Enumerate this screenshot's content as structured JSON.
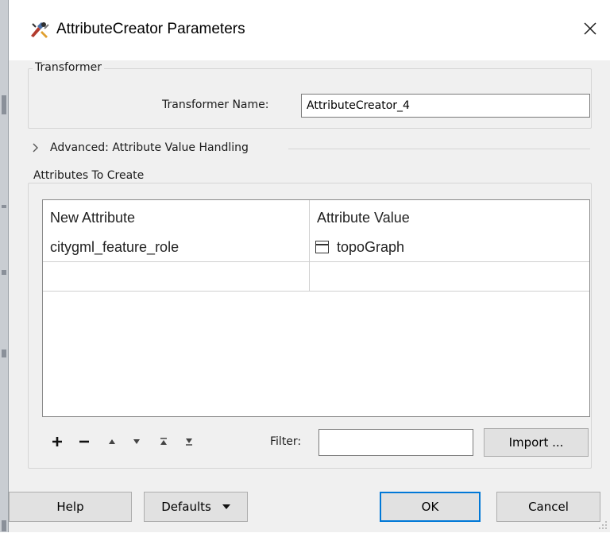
{
  "window": {
    "title": "AttributeCreator Parameters",
    "close_glyph": "✕"
  },
  "transformer_group": {
    "legend": "Transformer",
    "name_label": "Transformer Name:",
    "name_value": "AttributeCreator_4"
  },
  "advanced": {
    "chevron": "›",
    "label": "Advanced: Attribute Value Handling"
  },
  "attributes_group": {
    "legend": "Attributes To Create",
    "columns": [
      "New Attribute",
      "Attribute Value"
    ],
    "rows": [
      {
        "attribute": "citygml_feature_role",
        "value": "topoGraph"
      }
    ]
  },
  "toolbar": {
    "add_glyph": "+",
    "remove_glyph": "−",
    "filter_label": "Filter:",
    "filter_value": "",
    "import_label": "Import ..."
  },
  "footer": {
    "help_label": "Help",
    "defaults_label": "Defaults",
    "ok_label": "OK",
    "cancel_label": "Cancel"
  },
  "icons": {
    "title": "transformer-icon",
    "close": "close-icon",
    "expand": "chevron-right-icon",
    "value_type": "text-value-icon",
    "add": "plus-icon",
    "remove": "minus-icon",
    "move_up": "arrow-up-icon",
    "move_down": "arrow-down-icon",
    "move_top": "move-to-top-icon",
    "move_bottom": "move-to-bottom-icon",
    "defaults_menu": "caret-down-icon"
  },
  "colors": {
    "dialog_bg": "#f0f0f0",
    "title_bg": "#ffffff",
    "primary_border": "#0078d7",
    "button_bg": "#e1e1e1"
  }
}
